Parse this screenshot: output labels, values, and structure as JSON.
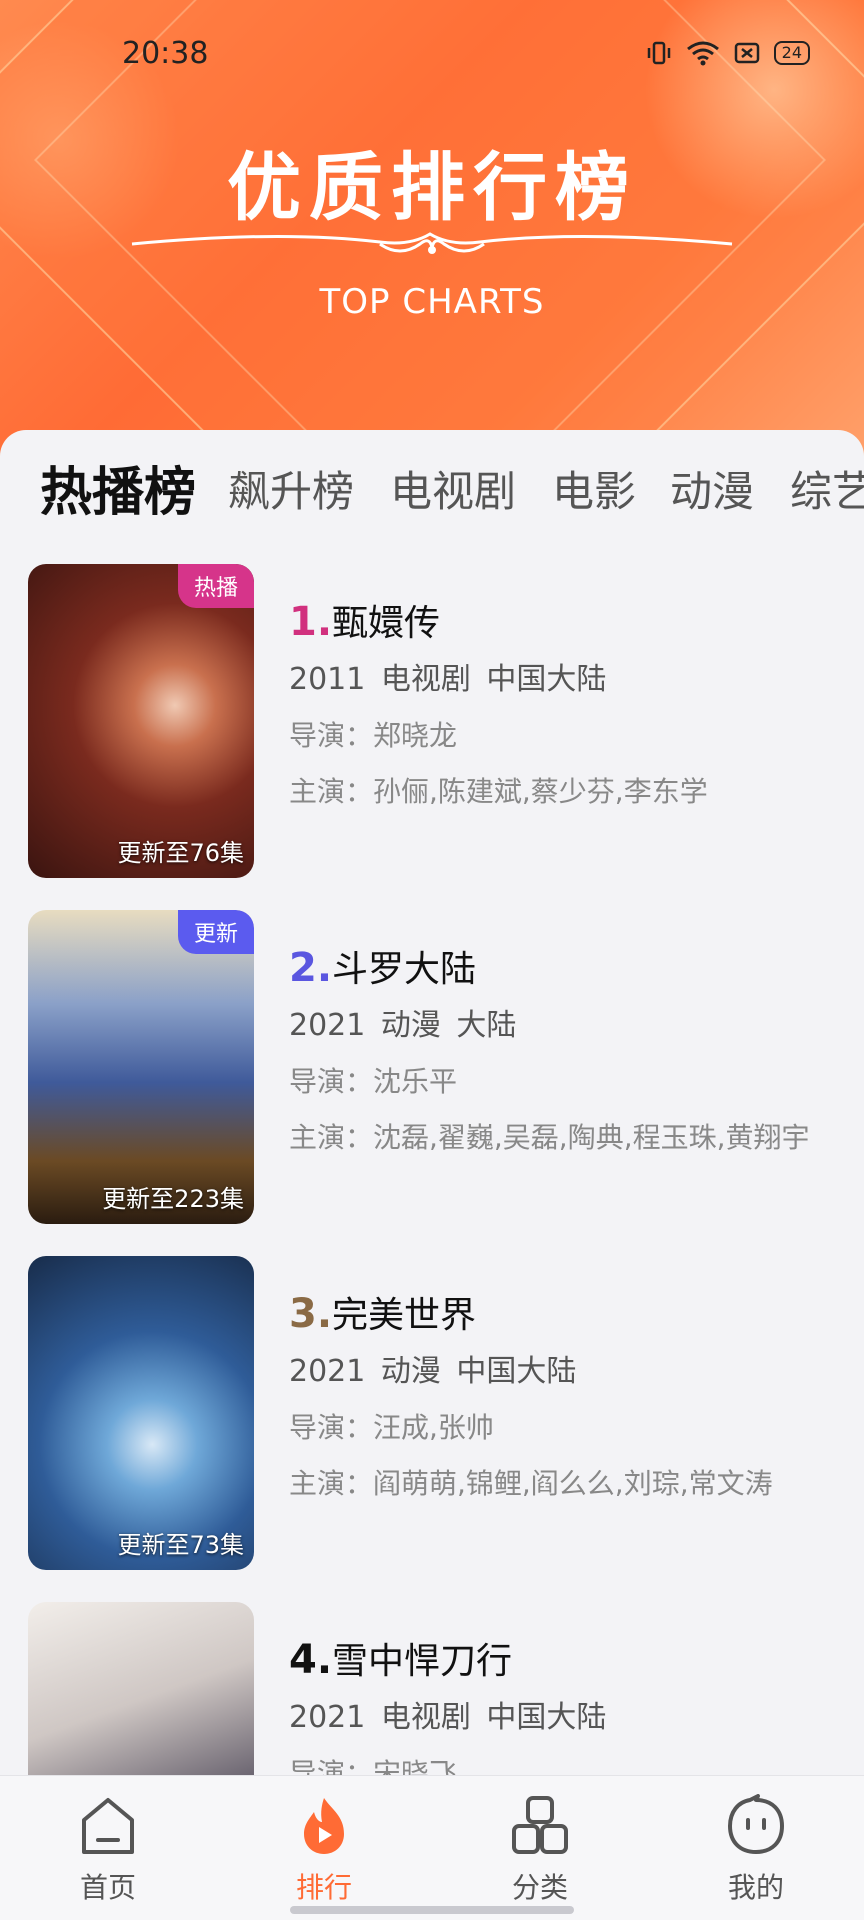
{
  "status_bar": {
    "time": "20:38",
    "battery": "24"
  },
  "banner": {
    "title": "优质排行榜",
    "subtitle": "TOP CHARTS"
  },
  "tabs": [
    {
      "label": "热播榜",
      "active": true
    },
    {
      "label": "飙升榜",
      "active": false
    },
    {
      "label": "电视剧",
      "active": false
    },
    {
      "label": "电影",
      "active": false
    },
    {
      "label": "动漫",
      "active": false
    },
    {
      "label": "综艺",
      "active": false
    }
  ],
  "items": [
    {
      "rank": "1.",
      "rank_color": "#d1307e",
      "title": "甄嬛传",
      "meta": "2011  电视剧  中国大陆",
      "director": "导演：郑晓龙",
      "cast": "主演：孙俪,陈建斌,蔡少芬,李东学",
      "badge": "热播",
      "badge_color": "#d6348a",
      "episodes": "更新至76集",
      "poster_colors": [
        "#7a2a1e",
        "#c95b3c",
        "#3a1410"
      ]
    },
    {
      "rank": "2.",
      "rank_color": "#5a56e0",
      "title": "斗罗大陆",
      "meta": "2021  动漫  大陆",
      "director": "导演：沈乐平",
      "cast": "主演：沈磊,翟巍,吴磊,陶典,程玉珠,黄翔宇",
      "badge": "更新",
      "badge_color": "#5b5bef",
      "episodes": "更新至223集",
      "poster_colors": [
        "#d9c7a0",
        "#5b6fa8",
        "#2a1c10"
      ]
    },
    {
      "rank": "3.",
      "rank_color": "#8a6a45",
      "title": "完美世界",
      "meta": "2021  动漫  中国大陆",
      "director": "导演：汪成,张帅",
      "cast": "主演：阎萌萌,锦鲤,阎么么,刘琮,常文涛",
      "badge": "",
      "badge_color": "",
      "episodes": "更新至73集",
      "poster_colors": [
        "#1d3a6e",
        "#6fa8d8",
        "#182c4a"
      ]
    },
    {
      "rank": "4.",
      "rank_color": "#111111",
      "title": "雪中悍刀行",
      "meta": "2021  电视剧  中国大陆",
      "director": "导演：宋晓飞",
      "cast": "",
      "badge": "",
      "badge_color": "",
      "episodes": "",
      "poster_colors": [
        "#e9e4e0",
        "#a8a2a2",
        "#2c2c34"
      ]
    }
  ],
  "nav": [
    {
      "label": "首页",
      "icon": "home-icon",
      "active": false
    },
    {
      "label": "排行",
      "icon": "fire-play-icon",
      "active": true
    },
    {
      "label": "分类",
      "icon": "category-icon",
      "active": false
    },
    {
      "label": "我的",
      "icon": "profile-icon",
      "active": false
    }
  ],
  "colors": {
    "accent": "#ff6b35"
  }
}
